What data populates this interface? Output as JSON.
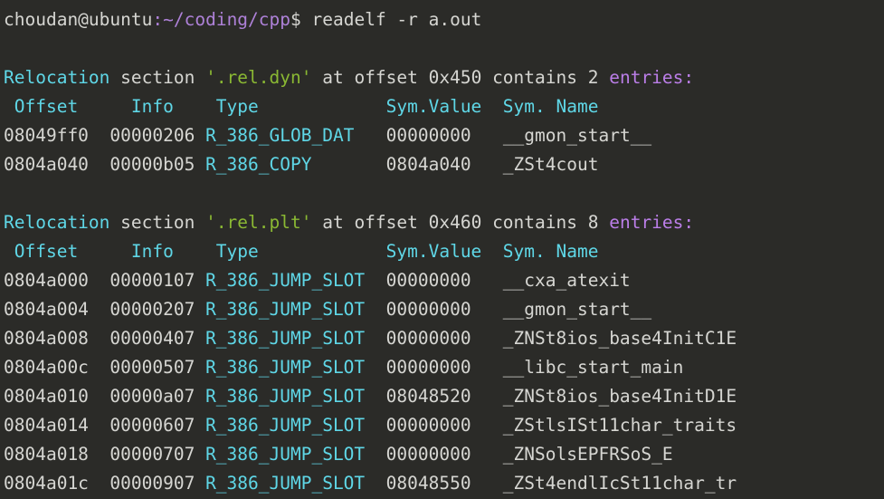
{
  "terminal": {
    "background": "#2b2b28",
    "foreground": "#d0d0cc",
    "accent_cyan": "#5fd7e7",
    "accent_magenta": "#bb7ee8",
    "accent_green": "#8ab833",
    "accent_purple": "#ae81d8"
  },
  "prompt": {
    "user_host": "choudan@ubuntu",
    "separator": ":",
    "path": "~/coding/cpp",
    "sigil": "$",
    "command": " readelf -r a.out"
  },
  "sections": [
    {
      "header": {
        "keyword": "Relocation",
        "word_section": " section ",
        "section_name": "'.rel.dyn'",
        "middle": " at offset 0x450 contains 2 ",
        "tail": "entries:"
      },
      "columns": {
        "offset": " Offset",
        "info": "Info",
        "type": "Type",
        "sym_value": "Sym.Value",
        "sym_name": "Sym. Name"
      },
      "column_header_line": " Offset     Info    Type            Sym.Value  Sym. Name",
      "rows": [
        {
          "offset": "08049ff0",
          "info": "00000206",
          "type": "R_386_GLOB_DAT",
          "sym_value": "00000000",
          "sym_name": "__gmon_start__",
          "line_pre": "08049ff0  00000206 ",
          "line_mid": "   ",
          "line_val": "00000000   ",
          "line_post": "__gmon_start__"
        },
        {
          "offset": "0804a040",
          "info": "00000b05",
          "type": "R_386_COPY",
          "sym_value": "0804a040",
          "sym_name": "_ZSt4cout",
          "line_pre": "0804a040  00000b05 ",
          "line_mid": "       ",
          "line_val": "0804a040   ",
          "line_post": "_ZSt4cout"
        }
      ]
    },
    {
      "header": {
        "keyword": "Relocation",
        "word_section": " section ",
        "section_name": "'.rel.plt'",
        "middle": " at offset 0x460 contains 8 ",
        "tail": "entries:"
      },
      "columns": {
        "offset": " Offset",
        "info": "Info",
        "type": "Type",
        "sym_value": "Sym.Value",
        "sym_name": "Sym. Name"
      },
      "column_header_line": " Offset     Info    Type            Sym.Value  Sym. Name",
      "rows": [
        {
          "offset": "0804a000",
          "info": "00000107",
          "type": "R_386_JUMP_SLOT",
          "sym_value": "00000000",
          "sym_name": "__cxa_atexit",
          "line_pre": "0804a000  00000107 ",
          "line_mid": "  ",
          "line_val": "00000000   ",
          "line_post": "__cxa_atexit"
        },
        {
          "offset": "0804a004",
          "info": "00000207",
          "type": "R_386_JUMP_SLOT",
          "sym_value": "00000000",
          "sym_name": "__gmon_start__",
          "line_pre": "0804a004  00000207 ",
          "line_mid": "  ",
          "line_val": "00000000   ",
          "line_post": "__gmon_start__"
        },
        {
          "offset": "0804a008",
          "info": "00000407",
          "type": "R_386_JUMP_SLOT",
          "sym_value": "00000000",
          "sym_name": "_ZNSt8ios_base4InitC1E",
          "line_pre": "0804a008  00000407 ",
          "line_mid": "  ",
          "line_val": "00000000   ",
          "line_post": "_ZNSt8ios_base4InitC1E"
        },
        {
          "offset": "0804a00c",
          "info": "00000507",
          "type": "R_386_JUMP_SLOT",
          "sym_value": "00000000",
          "sym_name": "__libc_start_main",
          "line_pre": "0804a00c  00000507 ",
          "line_mid": "  ",
          "line_val": "00000000   ",
          "line_post": "__libc_start_main"
        },
        {
          "offset": "0804a010",
          "info": "00000a07",
          "type": "R_386_JUMP_SLOT",
          "sym_value": "08048520",
          "sym_name": "_ZNSt8ios_base4InitD1E",
          "line_pre": "0804a010  00000a07 ",
          "line_mid": "  ",
          "line_val": "08048520   ",
          "line_post": "_ZNSt8ios_base4InitD1E"
        },
        {
          "offset": "0804a014",
          "info": "00000607",
          "type": "R_386_JUMP_SLOT",
          "sym_value": "00000000",
          "sym_name": "_ZStlsISt11char_traits",
          "line_pre": "0804a014  00000607 ",
          "line_mid": "  ",
          "line_val": "00000000   ",
          "line_post": "_ZStlsISt11char_traits"
        },
        {
          "offset": "0804a018",
          "info": "00000707",
          "type": "R_386_JUMP_SLOT",
          "sym_value": "00000000",
          "sym_name": "_ZNSolsEPFRSoS_E",
          "line_pre": "0804a018  00000707 ",
          "line_mid": "  ",
          "line_val": "00000000   ",
          "line_post": "_ZNSolsEPFRSoS_E"
        },
        {
          "offset": "0804a01c",
          "info": "00000907",
          "type": "R_386_JUMP_SLOT",
          "sym_value": "08048550",
          "sym_name": "_ZSt4endlIcSt11char_tr",
          "line_pre": "0804a01c  00000907 ",
          "line_mid": "  ",
          "line_val": "08048550   ",
          "line_post": "_ZSt4endlIcSt11char_tr"
        }
      ]
    }
  ]
}
